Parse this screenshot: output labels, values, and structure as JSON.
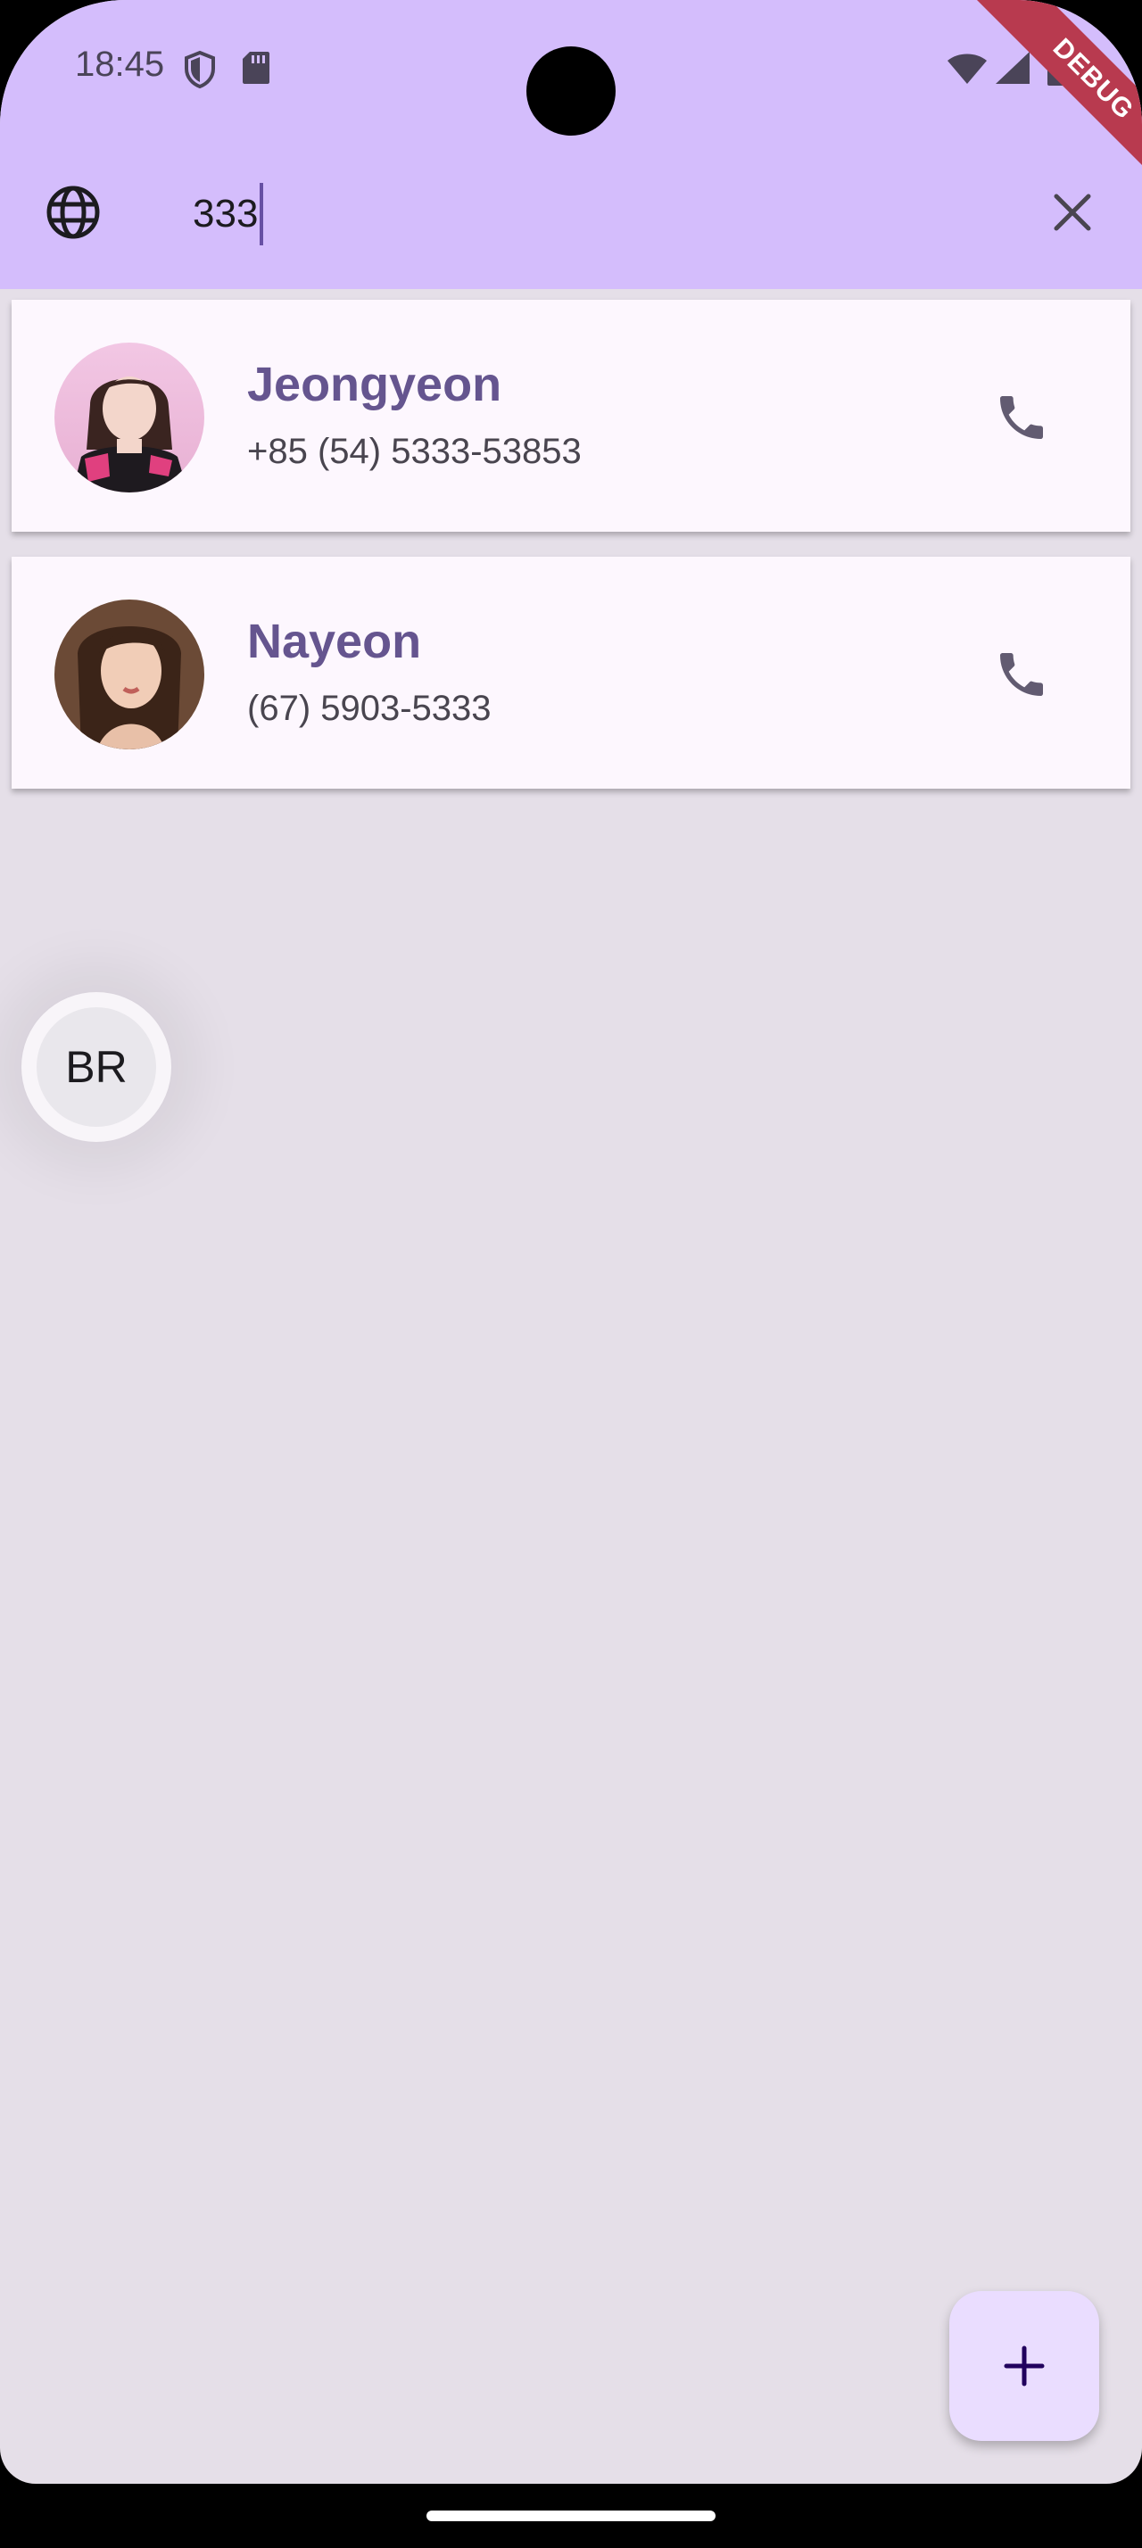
{
  "status_bar": {
    "time": "18:45"
  },
  "debug_banner": "DEBUG",
  "search": {
    "query": "333"
  },
  "contacts": [
    {
      "name": "Jeongyeon",
      "phone": "+85 (54) 5333-53853"
    },
    {
      "name": "Nayeon",
      "phone": "(67) 5903-5333"
    }
  ],
  "fast_scroll_label": "BR",
  "icons": {
    "appbar_leading": "globe-icon",
    "appbar_trailing": "close-icon",
    "contact_action": "call-icon",
    "fab": "add-icon"
  },
  "colors": {
    "appbar": "#d4bdfc",
    "background": "#e5dfe8",
    "card": "#fdf7fe",
    "name": "#65558f",
    "fab": "#eaddff",
    "debug": "#b83a4f"
  }
}
